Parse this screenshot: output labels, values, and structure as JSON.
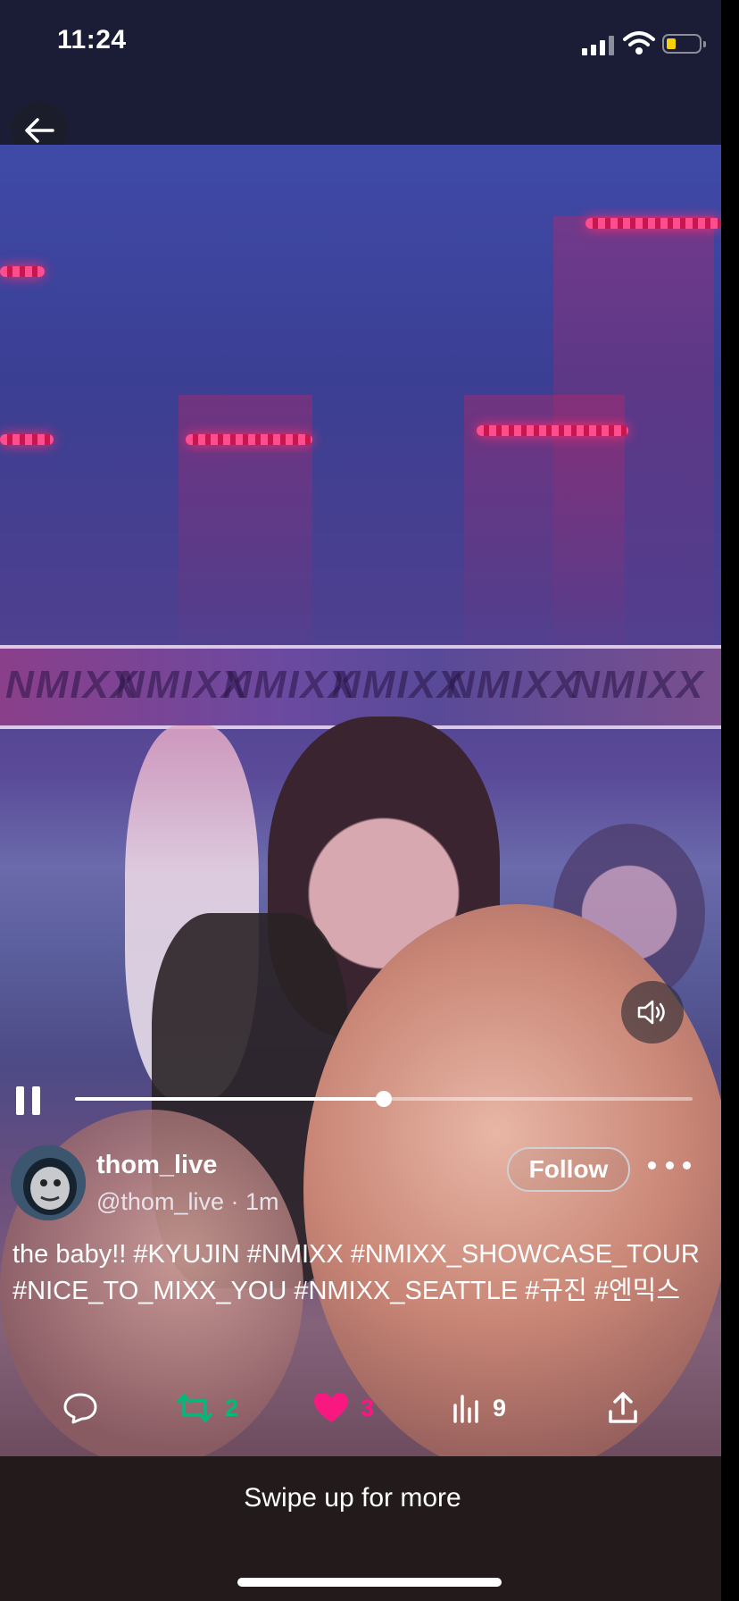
{
  "status_bar": {
    "time": "11:24"
  },
  "post": {
    "display_name": "thom_live",
    "handle": "@thom_live · 1m",
    "follow_label": "Follow",
    "caption": "the baby!! #KYUJIN #NMIXX #NMIXX_SHOWCASE_TOUR #NICE_TO_MIXX_YOU #NMIXX_SEATTLE #규진 #엔믹스",
    "video_banner_text": [
      "NMIXX",
      "NMIXX",
      "NMIXX",
      "NMIXX",
      "NMIXX",
      "NMIXX"
    ],
    "progress_fraction": 0.5
  },
  "actions": {
    "replies": "",
    "reposts": "2",
    "likes": "3",
    "views": "9"
  },
  "colors": {
    "repost_green": "#00ba7c",
    "like_pink": "#f91880",
    "bar_bg": "#1b1d36",
    "bottom_bg": "#231b1b"
  },
  "footer": {
    "swipe_label": "Swipe up for more"
  }
}
